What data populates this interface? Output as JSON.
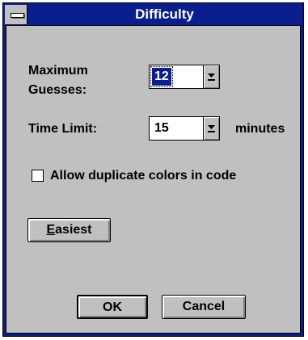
{
  "dialog": {
    "title": "Difficulty",
    "max_guesses": {
      "label_line1": "Maximum",
      "label_line2": "Guesses:",
      "value": "12"
    },
    "time_limit": {
      "label": "Time Limit:",
      "value": "15",
      "unit": "minutes"
    },
    "duplicates": {
      "label": "Allow duplicate colors in code",
      "checked": false
    },
    "easiest": {
      "mnemonic": "E",
      "rest": "asiest"
    },
    "ok_label": "OK",
    "cancel_label": "Cancel"
  }
}
